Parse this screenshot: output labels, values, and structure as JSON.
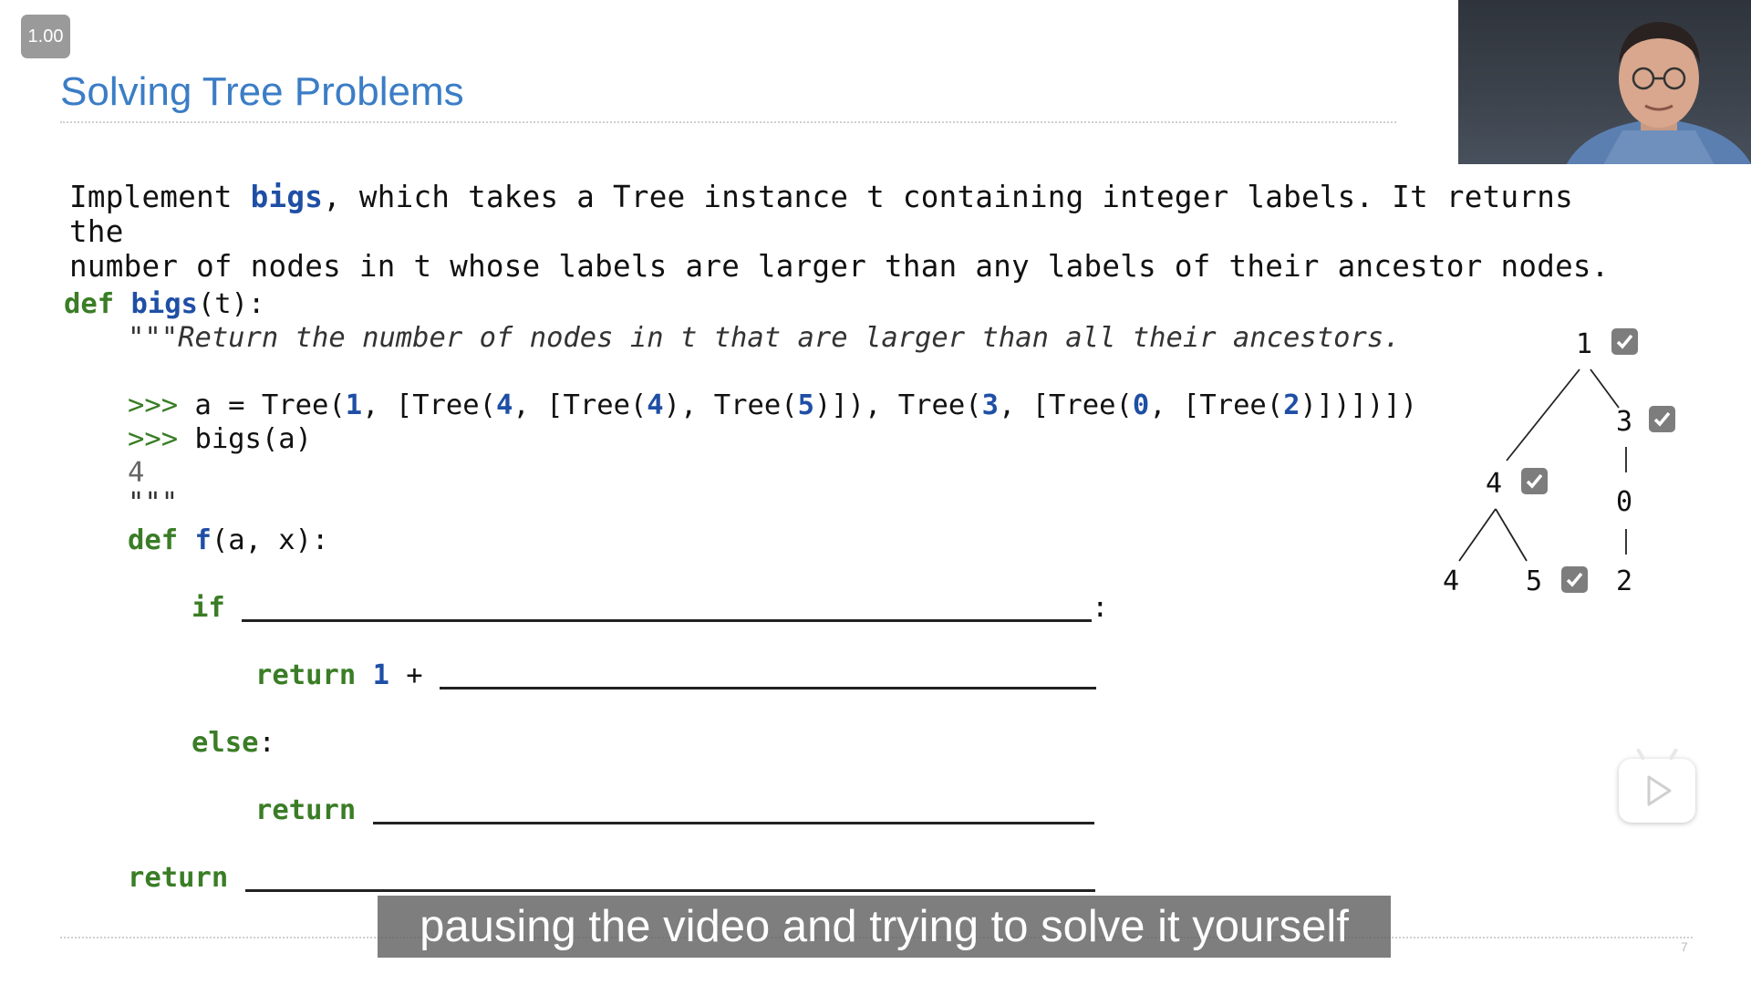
{
  "player": {
    "speed": "1.00",
    "subtitle": "pausing the video and trying to solve it yourself",
    "page_number": "7"
  },
  "slide": {
    "title": "Solving Tree Problems",
    "description": {
      "pre": "Implement ",
      "keyword": "bigs",
      "post_line1": ", which takes a Tree instance t containing integer labels. It returns the",
      "line2": "number of nodes in t whose labels are larger than any labels of their ancestor nodes."
    },
    "code": {
      "def_kw": "def",
      "func_name": "bigs",
      "func_params": "(t):",
      "docstring": "\"\"\"Return the number of nodes in t that are larger than all their ancestors.",
      "prompt": ">>>",
      "example_a": " a = Tree(",
      "n1": "1",
      "s1": ", [Tree(",
      "n4a": "4",
      "s2": ", [Tree(",
      "n4b": "4",
      "s3": "), Tree(",
      "n5": "5",
      "s4": ")]), Tree(",
      "n3": "3",
      "s5": ", [Tree(",
      "n0": "0",
      "s6": ", [Tree(",
      "n2": "2",
      "s7": ")])])])",
      "example_call": " bigs(a)",
      "example_output": "4",
      "doc_close": "\"\"\"",
      "inner_def_kw": "def",
      "inner_name": "f",
      "inner_params": "(a, x):",
      "if_kw": "if",
      "colon": ":",
      "return_kw": "return",
      "one": "1",
      "plus": " +",
      "else_kw": "else",
      "else_colon": ":"
    },
    "tree": {
      "labels": [
        "1",
        "3",
        "4",
        "0",
        "4",
        "5",
        "2"
      ],
      "checked": [
        "1",
        "3",
        "4",
        "5"
      ]
    }
  }
}
